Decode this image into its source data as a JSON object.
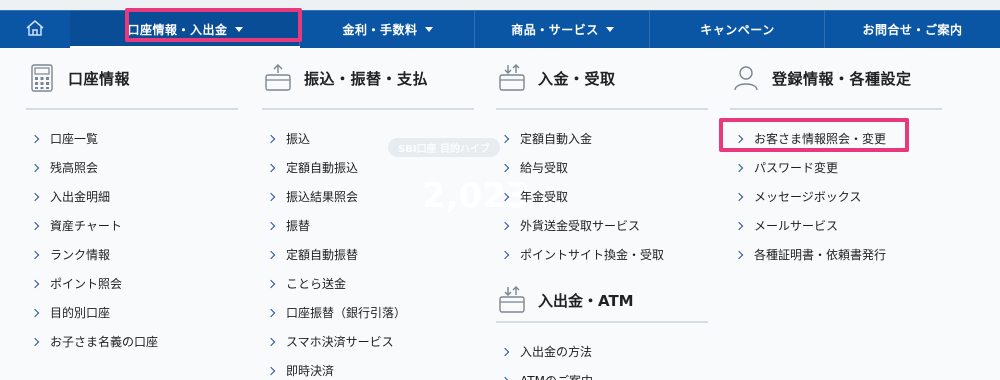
{
  "nav": {
    "home_icon": "home-icon",
    "items": [
      {
        "label": "口座情報・入出金",
        "caret": true
      },
      {
        "label": "金利・手数料",
        "caret": true
      },
      {
        "label": "商品・サービス",
        "caret": true
      },
      {
        "label": "キャンペーン",
        "caret": false
      },
      {
        "label": "お問合せ・ご案内",
        "caret": false
      }
    ]
  },
  "background": {
    "ghost_numbers": "2,023",
    "ghost_pill": "SBI口座 目的ハイブ"
  },
  "columns": [
    {
      "title": "口座情報",
      "icon": "calculator-icon",
      "items": [
        "口座一覧",
        "残高照会",
        "入出金明細",
        "資産チャート",
        "ランク情報",
        "ポイント照会",
        "目的別口座",
        "お子さま名義の口座"
      ]
    },
    {
      "title": "振込・振替・支払",
      "icon": "transfer-out-icon",
      "items": [
        "振込",
        "定額自動振込",
        "振込結果照会",
        "振替",
        "定額自動振替",
        "ことら送金",
        "口座振替（銀行引落）",
        "スマホ決済サービス",
        "即時決済"
      ]
    },
    {
      "title": "入金・受取",
      "icon": "deposit-in-icon",
      "items": [
        "定額自動入金",
        "給与受取",
        "年金受取",
        "外貨送金受取サービス",
        "ポイントサイト換金・受取"
      ],
      "sub": {
        "title": "入出金・ATM",
        "icon": "atm-icon",
        "items": [
          "入出金の方法",
          "ATMのご案内"
        ]
      }
    },
    {
      "title": "登録情報・各種設定",
      "icon": "user-icon",
      "items": [
        "お客さま情報照会・変更",
        "パスワード変更",
        "メッセージボックス",
        "メールサービス",
        "各種証明書・依頼書発行"
      ]
    }
  ],
  "colors": {
    "nav_bg": "#0b56a4",
    "highlight": "#e8397d",
    "chevron": "#27509b"
  }
}
